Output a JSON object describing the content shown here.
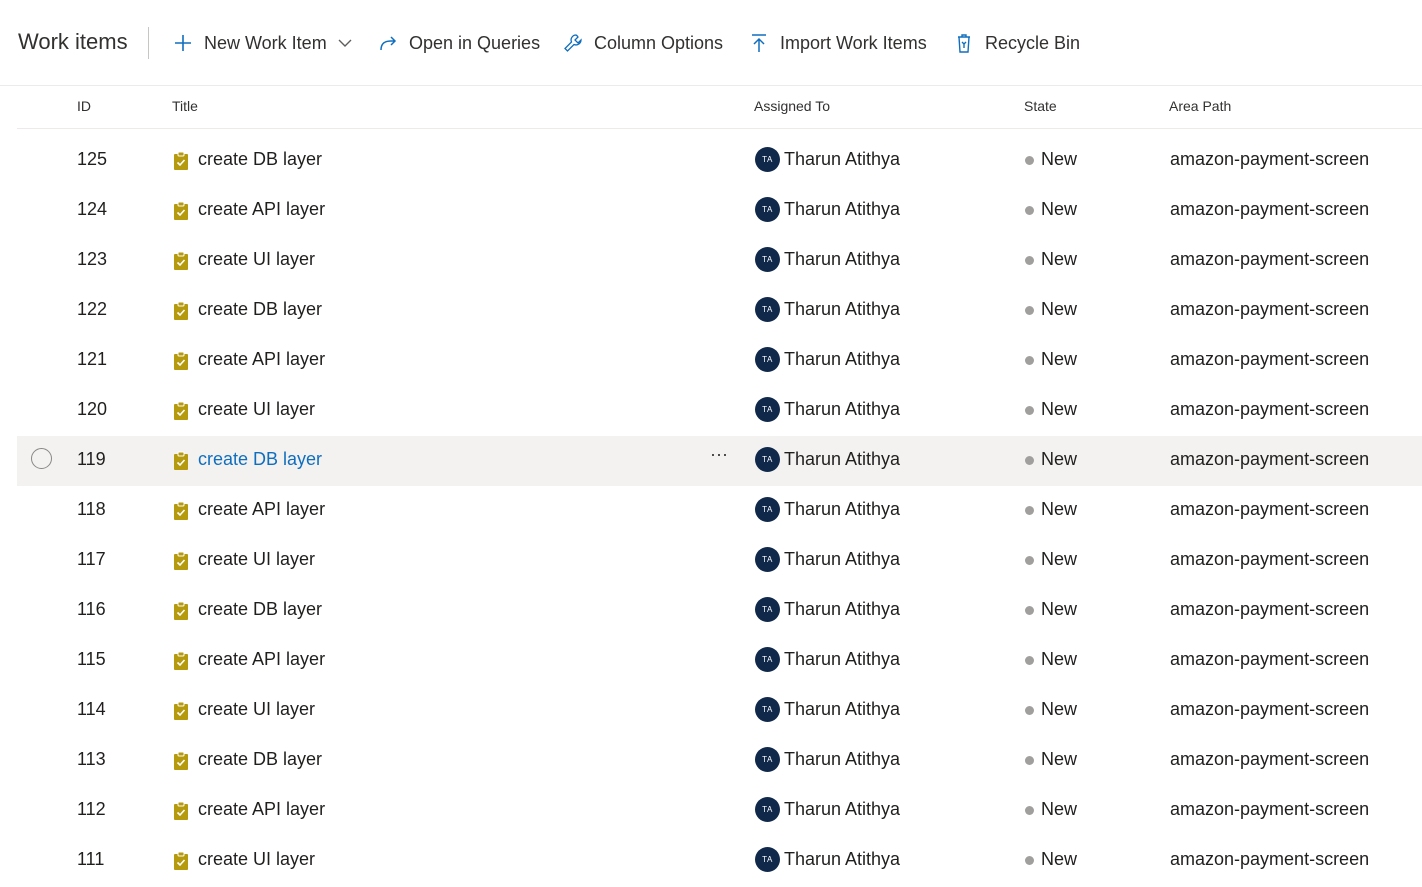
{
  "toolbar": {
    "page_title": "Work items",
    "new_work_item_label": "New Work Item",
    "open_in_queries_label": "Open in Queries",
    "column_options_label": "Column Options",
    "import_work_items_label": "Import Work Items",
    "recycle_bin_label": "Recycle Bin"
  },
  "columns": {
    "id": "ID",
    "title": "Title",
    "assigned_to": "Assigned To",
    "state": "State",
    "area_path": "Area Path"
  },
  "colors": {
    "task_icon": "#b59a0e",
    "avatar_bg": "#10284a",
    "state_new_dot": "#a19f9d",
    "link_hover": "#106ebe",
    "toolbar_icon": "#106ebe"
  },
  "more_actions_label": "···",
  "rows": [
    {
      "id": "125",
      "title": "create DB layer",
      "assigned_initials": "TA",
      "assigned_to": "Tharun Atithya",
      "state": "New",
      "area_path": "amazon-payment-screen",
      "hovered": false
    },
    {
      "id": "124",
      "title": "create API layer",
      "assigned_initials": "TA",
      "assigned_to": "Tharun Atithya",
      "state": "New",
      "area_path": "amazon-payment-screen",
      "hovered": false
    },
    {
      "id": "123",
      "title": "create UI layer",
      "assigned_initials": "TA",
      "assigned_to": "Tharun Atithya",
      "state": "New",
      "area_path": "amazon-payment-screen",
      "hovered": false
    },
    {
      "id": "122",
      "title": "create DB layer",
      "assigned_initials": "TA",
      "assigned_to": "Tharun Atithya",
      "state": "New",
      "area_path": "amazon-payment-screen",
      "hovered": false
    },
    {
      "id": "121",
      "title": "create API layer",
      "assigned_initials": "TA",
      "assigned_to": "Tharun Atithya",
      "state": "New",
      "area_path": "amazon-payment-screen",
      "hovered": false
    },
    {
      "id": "120",
      "title": "create UI layer",
      "assigned_initials": "TA",
      "assigned_to": "Tharun Atithya",
      "state": "New",
      "area_path": "amazon-payment-screen",
      "hovered": false
    },
    {
      "id": "119",
      "title": "create DB layer",
      "assigned_initials": "TA",
      "assigned_to": "Tharun Atithya",
      "state": "New",
      "area_path": "amazon-payment-screen",
      "hovered": true
    },
    {
      "id": "118",
      "title": "create API layer",
      "assigned_initials": "TA",
      "assigned_to": "Tharun Atithya",
      "state": "New",
      "area_path": "amazon-payment-screen",
      "hovered": false
    },
    {
      "id": "117",
      "title": "create UI layer",
      "assigned_initials": "TA",
      "assigned_to": "Tharun Atithya",
      "state": "New",
      "area_path": "amazon-payment-screen",
      "hovered": false
    },
    {
      "id": "116",
      "title": "create DB layer",
      "assigned_initials": "TA",
      "assigned_to": "Tharun Atithya",
      "state": "New",
      "area_path": "amazon-payment-screen",
      "hovered": false
    },
    {
      "id": "115",
      "title": "create API layer",
      "assigned_initials": "TA",
      "assigned_to": "Tharun Atithya",
      "state": "New",
      "area_path": "amazon-payment-screen",
      "hovered": false
    },
    {
      "id": "114",
      "title": "create UI layer",
      "assigned_initials": "TA",
      "assigned_to": "Tharun Atithya",
      "state": "New",
      "area_path": "amazon-payment-screen",
      "hovered": false
    },
    {
      "id": "113",
      "title": "create DB layer",
      "assigned_initials": "TA",
      "assigned_to": "Tharun Atithya",
      "state": "New",
      "area_path": "amazon-payment-screen",
      "hovered": false
    },
    {
      "id": "112",
      "title": "create API layer",
      "assigned_initials": "TA",
      "assigned_to": "Tharun Atithya",
      "state": "New",
      "area_path": "amazon-payment-screen",
      "hovered": false
    },
    {
      "id": "111",
      "title": "create UI layer",
      "assigned_initials": "TA",
      "assigned_to": "Tharun Atithya",
      "state": "New",
      "area_path": "amazon-payment-screen",
      "hovered": false
    }
  ]
}
